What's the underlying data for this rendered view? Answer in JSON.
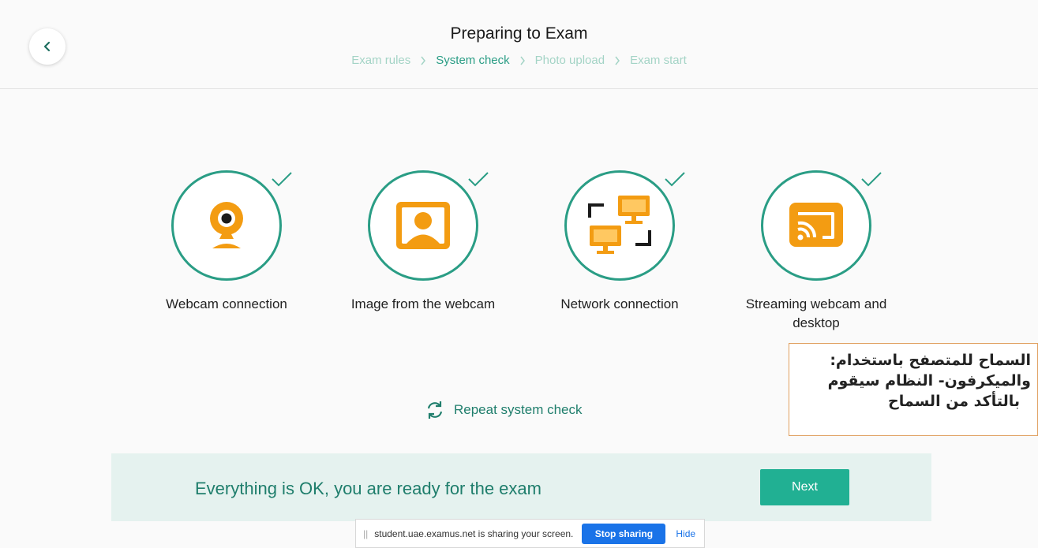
{
  "header": {
    "title": "Preparing to Exam",
    "steps": [
      "Exam rules",
      "System check",
      "Photo upload",
      "Exam start"
    ],
    "active_step_index": 1
  },
  "checks": [
    {
      "label": "Webcam connection",
      "icon": "webcam-icon",
      "status": "passed"
    },
    {
      "label": "Image from the webcam",
      "icon": "user-portrait-icon",
      "status": "passed"
    },
    {
      "label": "Network connection",
      "icon": "network-computers-icon",
      "status": "passed"
    },
    {
      "label": "Streaming webcam and desktop",
      "icon": "cast-stream-icon",
      "status": "passed"
    }
  ],
  "repeat_label": "Repeat system check",
  "annotation": {
    "lines": [
      "السماح للمتصفح باستخدام:",
      "والميكرفون- النظام سيقوم",
      "بالتأكد من السماح"
    ]
  },
  "banner": {
    "message": "Everything is OK, you are ready for the exam",
    "next_label": "Next"
  },
  "share_bar": {
    "message": "student.uae.examus.net is sharing your screen.",
    "stop_label": "Stop sharing",
    "hide_label": "Hide"
  },
  "colors": {
    "accent": "#2a9d85",
    "icon_orange": "#f39c12",
    "step_inactive": "#a4d4c6",
    "banner_bg": "#e5f2ef",
    "next_button": "#21b093",
    "stop_button": "#1a73e8"
  }
}
